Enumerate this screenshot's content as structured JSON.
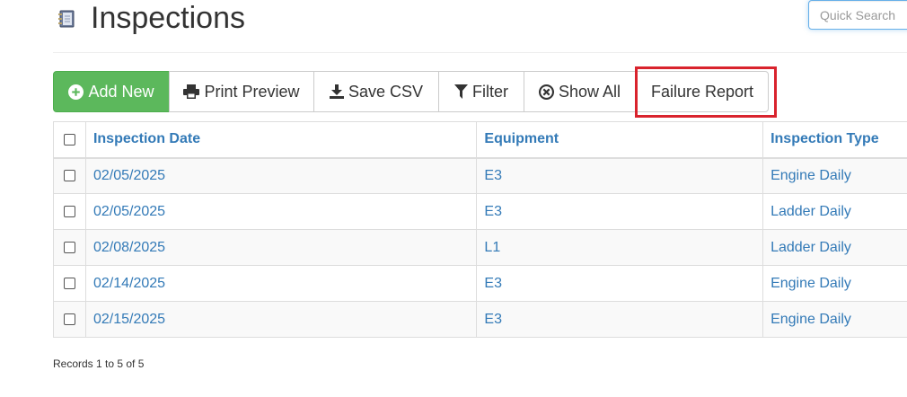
{
  "header": {
    "title": "Inspections",
    "search_placeholder": "Quick Search"
  },
  "toolbar": {
    "add_new": "Add New",
    "print_preview": "Print Preview",
    "save_csv": "Save CSV",
    "filter": "Filter",
    "show_all": "Show All",
    "failure_report": "Failure Report"
  },
  "table": {
    "columns": [
      "Inspection Date",
      "Equipment",
      "Inspection Type"
    ],
    "rows": [
      {
        "date": "02/05/2025",
        "equipment": "E3",
        "type": "Engine Daily"
      },
      {
        "date": "02/05/2025",
        "equipment": "E3",
        "type": "Ladder Daily"
      },
      {
        "date": "02/08/2025",
        "equipment": "L1",
        "type": "Ladder Daily"
      },
      {
        "date": "02/14/2025",
        "equipment": "E3",
        "type": "Engine Daily"
      },
      {
        "date": "02/15/2025",
        "equipment": "E3",
        "type": "Engine Daily"
      }
    ]
  },
  "footer": {
    "records_text": "Records 1 to 5 of 5"
  },
  "colors": {
    "accent_green": "#5cb85c",
    "link_blue": "#337ab7",
    "highlight_red": "#d9232d"
  },
  "icons": [
    "notebook-icon",
    "plus-circle-icon",
    "printer-icon",
    "download-icon",
    "filter-icon",
    "times-circle-icon"
  ]
}
